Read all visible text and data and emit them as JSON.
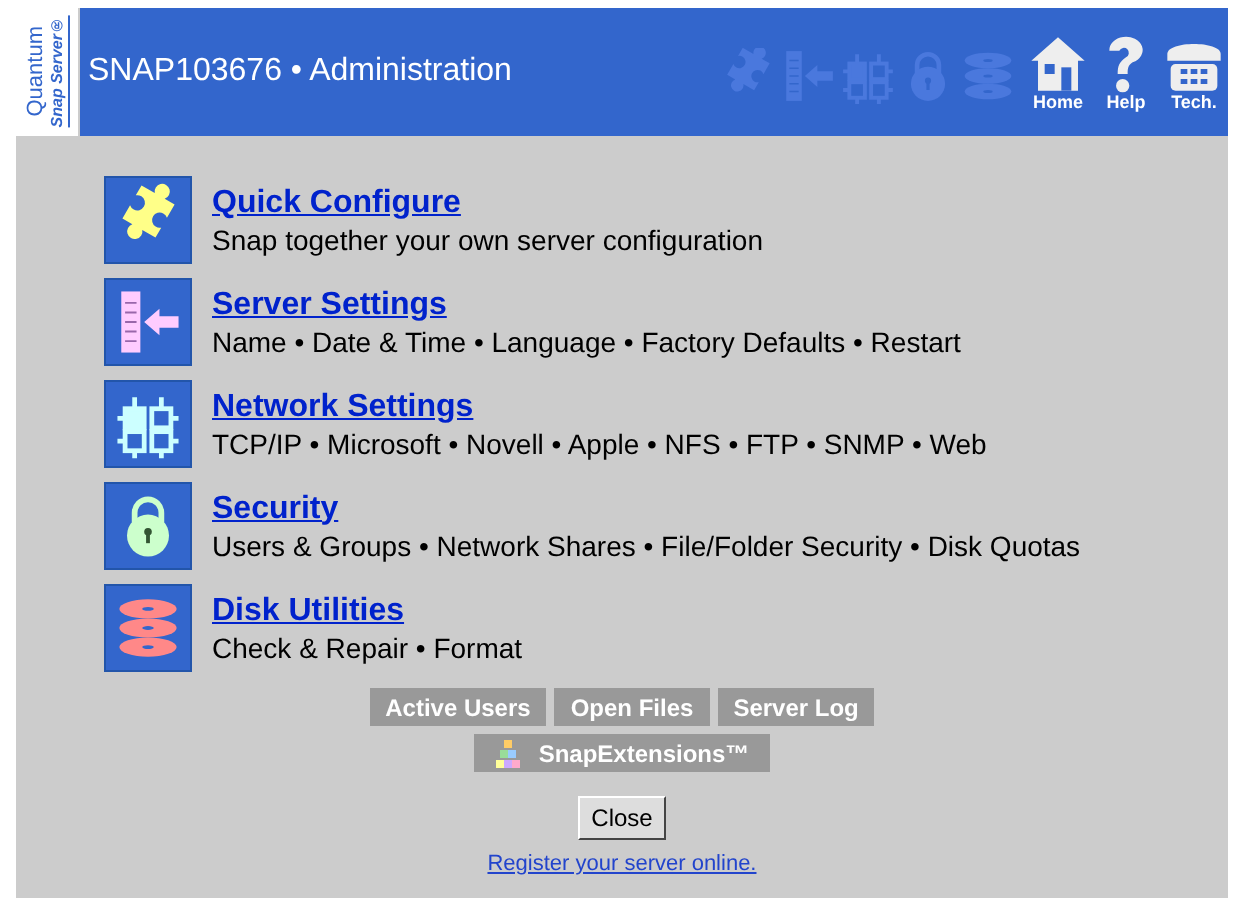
{
  "header": {
    "logo": {
      "brand": "Quantum",
      "product": "Snap Server®"
    },
    "title": "SNAP103676 • Administration",
    "nav": [
      {
        "kind": "home",
        "label": "Home"
      },
      {
        "kind": "help",
        "label": "Help"
      },
      {
        "kind": "tech",
        "label": "Tech."
      }
    ]
  },
  "menu": [
    {
      "kind": "puzzle",
      "title": "Quick Configure",
      "description": "Snap together your own server configuration"
    },
    {
      "kind": "server",
      "title": "Server Settings",
      "description": "Name • Date & Time • Language • Factory Defaults • Restart"
    },
    {
      "kind": "network",
      "title": "Network Settings",
      "description": "TCP/IP • Microsoft • Novell • Apple • NFS • FTP • SNMP • Web"
    },
    {
      "kind": "lock",
      "title": "Security",
      "description": "Users & Groups • Network Shares • File/Folder Security • Disk Quotas"
    },
    {
      "kind": "disks",
      "title": "Disk Utilities",
      "description": "Check & Repair • Format"
    }
  ],
  "tool_buttons": [
    "Active Users",
    "Open Files",
    "Server Log"
  ],
  "extensions_button": "SnapExtensions™",
  "close_button": "Close",
  "register_link": "Register your server online."
}
